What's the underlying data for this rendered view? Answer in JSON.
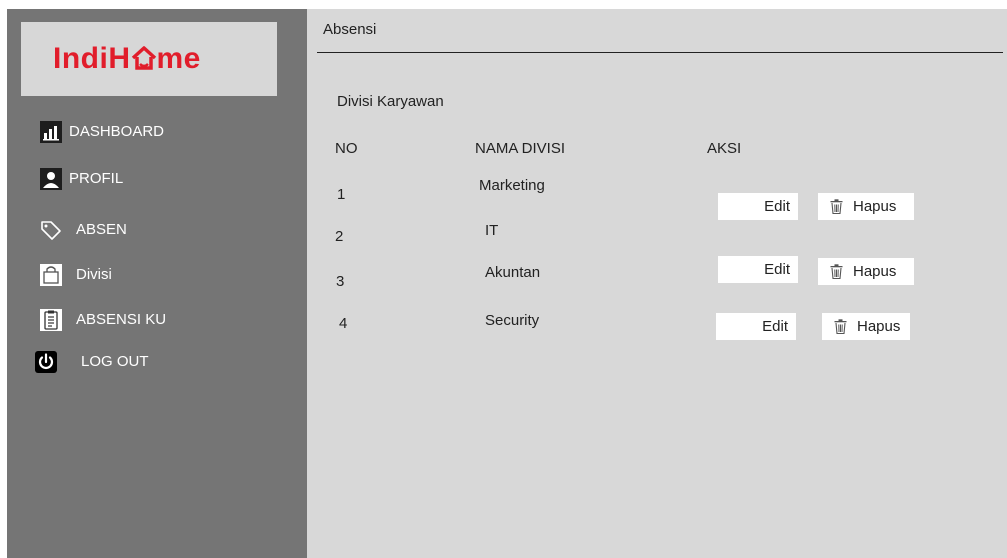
{
  "brand": {
    "logo_text_before": "IndiH",
    "logo_text_after": "me",
    "logo_color": "#e11d2b"
  },
  "sidebar": {
    "items": [
      {
        "label": "DASHBOARD",
        "icon": "chart-icon"
      },
      {
        "label": "PROFIL",
        "icon": "user-icon"
      },
      {
        "label": "ABSEN",
        "icon": "tag-icon"
      },
      {
        "label": "Divisi",
        "icon": "bag-icon"
      },
      {
        "label": "ABSENSI KU",
        "icon": "clipboard-icon"
      },
      {
        "label": "LOG OUT",
        "icon": "power-icon"
      }
    ]
  },
  "header": {
    "title": "Absensi"
  },
  "main": {
    "section_title": "Divisi Karyawan",
    "columns": [
      "NO",
      "NAMA DIVISI",
      "AKSI"
    ],
    "rows": [
      {
        "no": "1",
        "nama": "Marketing"
      },
      {
        "no": "2",
        "nama": "IT"
      },
      {
        "no": "3",
        "nama": "Akuntan"
      },
      {
        "no": "4",
        "nama": "Security"
      }
    ],
    "actions": {
      "edit_label": "Edit",
      "hapus_label": "Hapus"
    }
  }
}
